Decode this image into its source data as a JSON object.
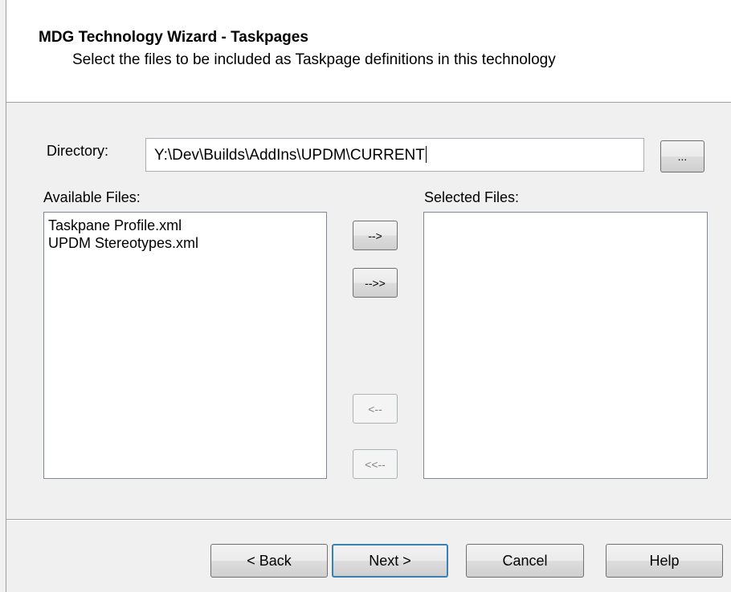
{
  "header": {
    "title": "MDG Technology Wizard - Taskpages",
    "subtitle": "Select the files to be included as Taskpage definitions in this technology"
  },
  "directory": {
    "label": "Directory:",
    "value": "Y:\\Dev\\Builds\\AddIns\\UPDM\\CURRENT",
    "browse_label": "..."
  },
  "available": {
    "label": "Available Files:",
    "items": [
      "Taskpane Profile.xml",
      "UPDM Stereotypes.xml"
    ]
  },
  "selected": {
    "label": "Selected Files:",
    "items": []
  },
  "transfer": {
    "add": "-->",
    "add_all": "-->>",
    "remove": "<--",
    "remove_all": "<<--"
  },
  "footer": {
    "back": "< Back",
    "next": "Next >",
    "cancel": "Cancel",
    "help": "Help"
  }
}
